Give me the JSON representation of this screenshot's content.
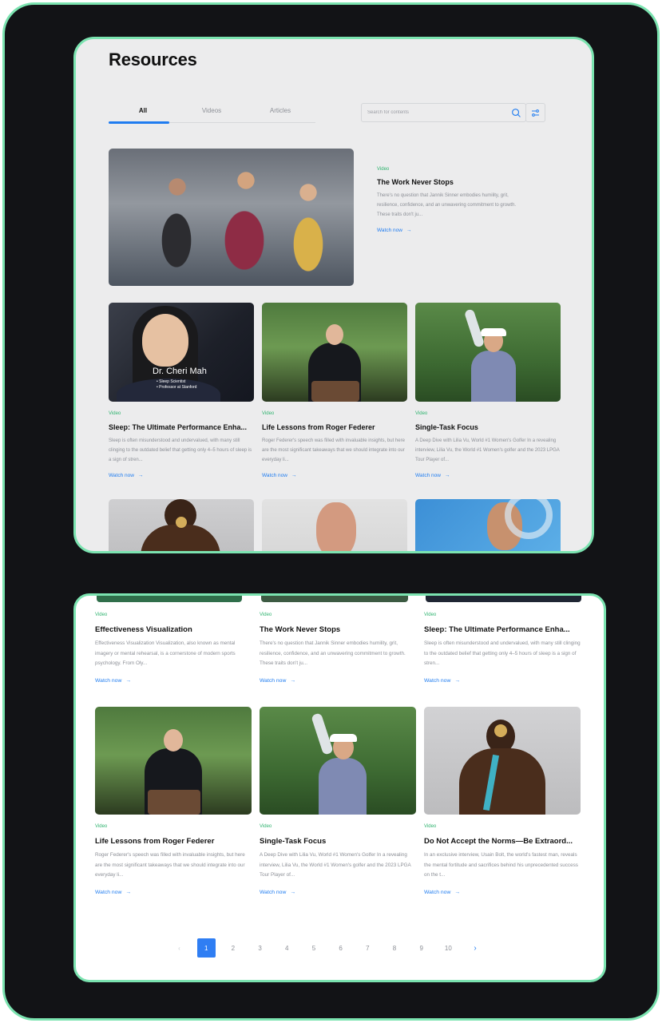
{
  "page": {
    "title": "Resources"
  },
  "tabs": [
    {
      "label": "All",
      "active": true
    },
    {
      "label": "Videos",
      "active": false
    },
    {
      "label": "Articles",
      "active": false
    }
  ],
  "search": {
    "placeholder": "Search for contents",
    "icon": "search-icon"
  },
  "filter": {
    "icon": "filter-icon"
  },
  "colors": {
    "accent": "#1f7cf0",
    "tag": "#2fb36f",
    "frame": "#7be3b0",
    "background": "#121316"
  },
  "featured": {
    "label": "Video",
    "title": "The Work Never Stops",
    "description": "There's no question that Jannik Sinner embodies humility, grit, resilience, confidence, and an unwavering commitment to growth. These traits don't ju...",
    "link": "Watch now"
  },
  "grid_top": [
    {
      "label": "Video",
      "title": "Sleep: The Ultimate Performance Enha...",
      "description": "Sleep is often misunderstood and undervalued, with many still clinging to the outdated belief that getting only 4–5 hours of sleep is a sign of stren...",
      "link": "Watch now",
      "overlay_name": "Dr. Cheri Mah",
      "overlay_lines": [
        "• Sleep Scientist",
        "• Professor at Stanford"
      ]
    },
    {
      "label": "Video",
      "title": "Life Lessons from Roger Federer",
      "description": "Roger Federer's speech was filled with invaluable insights, but here are the most significant takeaways that we should integrate into our everyday li...",
      "link": "Watch now"
    },
    {
      "label": "Video",
      "title": "Single-Task Focus",
      "description": "A Deep Dive with Lilia Vu, World #1 Women's Golfer In a revealing interview, Lilia Vu, the World #1 Women's golfer and the 2023 LPGA Tour Player of...",
      "link": "Watch now"
    }
  ],
  "grid_bottom_row1": [
    {
      "label": "Video",
      "title": "Effectiveness Visualization",
      "description": "Effectiveness Visualization Visualization, also known as mental imagery or mental rehearsal, is a cornerstone of modern sports psychology. From Oly...",
      "link": "Watch now"
    },
    {
      "label": "Video",
      "title": "The Work Never Stops",
      "description": "There's no question that Jannik Sinner embodies humility, grit, resilience, confidence, and an unwavering commitment to growth. These traits don't ju...",
      "link": "Watch now"
    },
    {
      "label": "Video",
      "title": "Sleep: The Ultimate Performance Enha...",
      "description": "Sleep is often misunderstood and undervalued, with many still clinging to the outdated belief that getting only 4–5 hours of sleep is a sign of stren...",
      "link": "Watch now"
    }
  ],
  "grid_bottom_row2": [
    {
      "label": "Video",
      "title": "Life Lessons from Roger Federer",
      "description": "Roger Federer's speech was filled with invaluable insights, but here are the most significant takeaways that we should integrate into our everyday li...",
      "link": "Watch now"
    },
    {
      "label": "Video",
      "title": "Single-Task Focus",
      "description": "A Deep Dive with Lilia Vu, World #1 Women's Golfer In a revealing interview, Lilia Vu, the World #1 Women's golfer and the 2023 LPGA Tour Player of...",
      "link": "Watch now"
    },
    {
      "label": "Video",
      "title": "Do Not Accept the Norms—Be Extraord...",
      "description": "In an exclusive interview, Usain Bolt, the world's fastest man, reveals the mental fortitude and sacrifices behind his unprecedented success on the t...",
      "link": "Watch now"
    }
  ],
  "pagination": {
    "prev": "‹",
    "next": "›",
    "pages": [
      "1",
      "2",
      "3",
      "4",
      "5",
      "6",
      "7",
      "8",
      "9",
      "10"
    ],
    "current": "1"
  }
}
